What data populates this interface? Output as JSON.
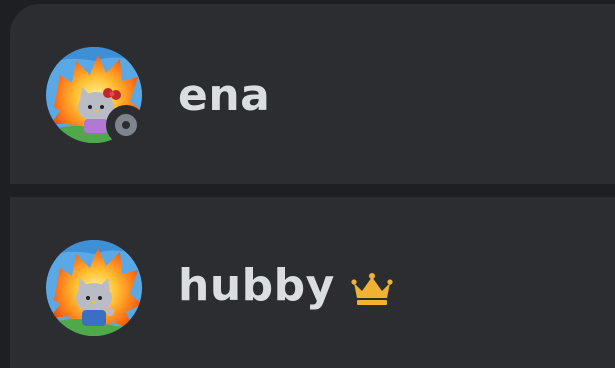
{
  "members": [
    {
      "name": "ena",
      "avatar": "hello-kitty-explosion-avatar-red-bow",
      "status": "offline",
      "status_icon": "offline-status-icon",
      "owner": false
    },
    {
      "name": "hubby",
      "avatar": "hello-kitty-explosion-avatar-blue-overalls",
      "status": "",
      "owner": true,
      "owner_icon": "crown-icon",
      "owner_color": "#f0b232"
    }
  ],
  "colors": {
    "background": "#1e1f22",
    "card": "#2b2d31",
    "text": "#dbdee1",
    "offline": "#80848e",
    "crown": "#f0b232"
  }
}
